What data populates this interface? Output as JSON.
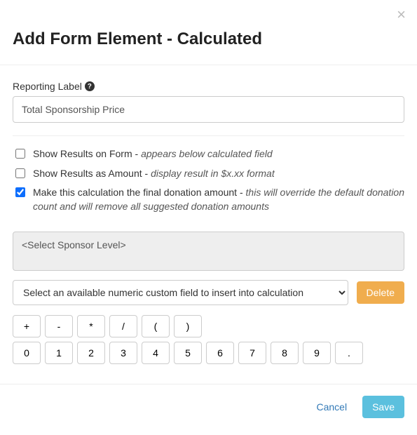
{
  "modal": {
    "title": "Add Form Element - Calculated",
    "close_symbol": "×"
  },
  "reporting_label": {
    "label": "Reporting Label",
    "help_symbol": "?",
    "value": "Total Sponsorship Price"
  },
  "options": {
    "show_results": {
      "checked": false,
      "label": "Show Results on Form",
      "hint": "appears below calculated field"
    },
    "show_amount": {
      "checked": false,
      "label": "Show Results as Amount",
      "hint": "display result in $x.xx format"
    },
    "final_donation": {
      "checked": true,
      "label": "Make this calculation the final donation amount",
      "hint": "this will override the default donation count and will remove all suggested donation amounts"
    }
  },
  "expression": {
    "value": "<Select Sponsor Level>"
  },
  "field_select": {
    "selected": "Select an available numeric custom field to insert into calculation"
  },
  "buttons": {
    "delete": "Delete",
    "cancel": "Cancel",
    "save": "Save"
  },
  "keypad": {
    "ops": [
      "+",
      "-",
      "*",
      "/",
      "(",
      ")"
    ],
    "nums": [
      "0",
      "1",
      "2",
      "3",
      "4",
      "5",
      "6",
      "7",
      "8",
      "9",
      "."
    ]
  }
}
